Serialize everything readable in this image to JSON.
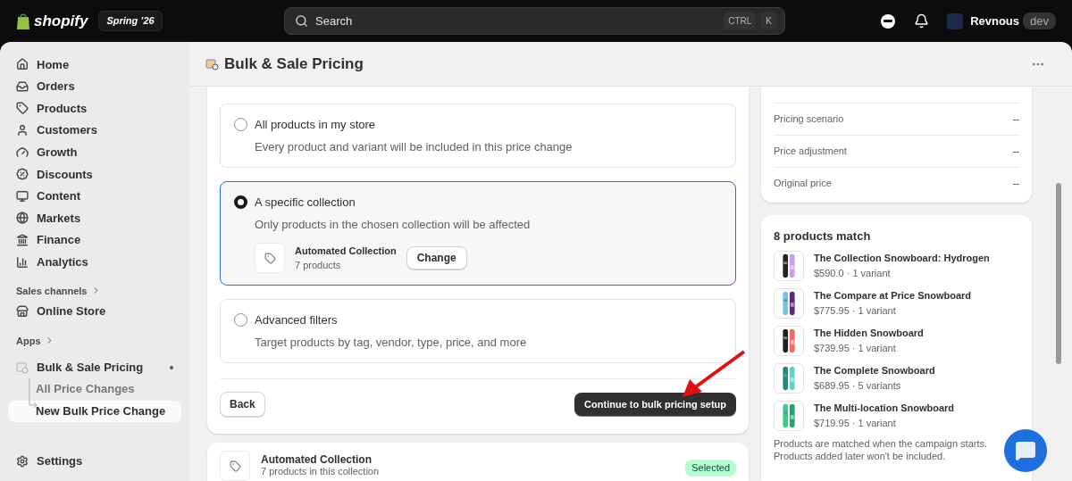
{
  "topbar": {
    "logo": "shopify",
    "edition": "Spring ’26",
    "search": {
      "placeholder": "Search",
      "shortcut": [
        "CTRL",
        "K"
      ]
    },
    "store": "Revnous",
    "store_badge": "dev"
  },
  "sidebar": {
    "items": [
      {
        "label": "Home",
        "selected": false
      },
      {
        "label": "Orders",
        "selected": false
      },
      {
        "label": "Products",
        "selected": false
      },
      {
        "label": "Customers",
        "selected": false
      },
      {
        "label": "Growth",
        "selected": false
      },
      {
        "label": "Discounts",
        "selected": false
      },
      {
        "label": "Content",
        "selected": false
      },
      {
        "label": "Markets",
        "selected": false
      },
      {
        "label": "Finance",
        "selected": false
      },
      {
        "label": "Analytics",
        "selected": false
      }
    ],
    "sales_channels": {
      "heading": "Sales channels",
      "items": [
        {
          "label": "Online Store",
          "selected": false
        }
      ]
    },
    "apps": {
      "heading": "Apps",
      "app": {
        "label": "Bulk & Sale Pricing",
        "children": [
          {
            "label": "All Price Changes",
            "selected": false
          },
          {
            "label": "New Bulk Price Change",
            "selected": true
          }
        ]
      }
    },
    "settings": "Settings"
  },
  "page": {
    "title": "Bulk & Sale Pricing"
  },
  "scope": {
    "options": [
      {
        "title": "All products in my store",
        "description": "Every product and variant will be included in this price change",
        "selected": false
      },
      {
        "title": "A specific collection",
        "description": "Only products in the chosen collection will be affected",
        "selected": true,
        "collection": {
          "name": "Automated Collection",
          "count": "7 products",
          "action": "Change"
        }
      },
      {
        "title": "Advanced filters",
        "description": "Target products by tag, vendor, type, price, and more",
        "selected": false
      }
    ],
    "back": "Back",
    "continue": "Continue to bulk pricing setup"
  },
  "collection_card": {
    "name": "Automated Collection",
    "count": "7 products in this collection",
    "badge": "Selected"
  },
  "summary": {
    "rows": [
      {
        "label": "Pricing scenario",
        "value": "--"
      },
      {
        "label": "Price adjustment",
        "value": "--"
      },
      {
        "label": "Original price",
        "value": "--"
      }
    ]
  },
  "matches": {
    "title": "8 products match",
    "products": [
      {
        "name": "The Collection Snowboard: Hydrogen",
        "meta": "$590.0 · 1 variant"
      },
      {
        "name": "The Compare at Price Snowboard",
        "meta": "$775.95 · 1 variant"
      },
      {
        "name": "The Hidden Snowboard",
        "meta": "$739.95 · 1 variant"
      },
      {
        "name": "The Complete Snowboard",
        "meta": "$689.95 · 5 variants"
      },
      {
        "name": "The Multi-location Snowboard",
        "meta": "$719.95 · 1 variant"
      }
    ],
    "note": "Products are matched when the campaign starts. Products added later won't be included."
  }
}
